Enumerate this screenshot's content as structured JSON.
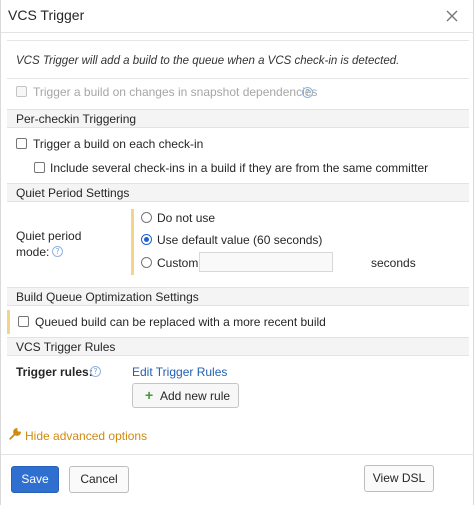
{
  "dialog": {
    "title": "VCS Trigger",
    "description": "VCS Trigger will add a build to the queue when a VCS check-in is detected."
  },
  "snapshot": {
    "label": "Trigger a build on changes in snapshot dependencies",
    "checked": false,
    "disabled": true
  },
  "per_checkin": {
    "header": "Per-checkin Triggering",
    "each_checkin_label": "Trigger a build on each check-in",
    "include_several_label": "Include several check-ins in a build if they are from the same committer"
  },
  "quiet_period": {
    "header": "Quiet Period Settings",
    "mode_label_1": "Quiet period",
    "mode_label_2": "mode:",
    "options": [
      "Do not use",
      "Use default value (60 seconds)",
      "Custom"
    ],
    "selected": "Use default value (60 seconds)",
    "custom_value": "",
    "seconds_label": "seconds"
  },
  "queue_optimization": {
    "header": "Build Queue Optimization Settings",
    "label": "Queued build can be replaced with a more recent build",
    "checked": false
  },
  "trigger_rules": {
    "header": "VCS Trigger Rules",
    "label": "Trigger rules:",
    "edit_link": "Edit Trigger Rules",
    "add_button": "Add new rule"
  },
  "advanced": {
    "label": "Hide advanced options"
  },
  "footer": {
    "save": "Save",
    "cancel": "Cancel",
    "view_dsl": "View DSL"
  },
  "colors": {
    "primary": "#2f6fcf",
    "link": "#1f5fb4",
    "accent_bar": "#f3d58a",
    "advanced": "#d08a0e",
    "plus": "#3c9b35"
  }
}
